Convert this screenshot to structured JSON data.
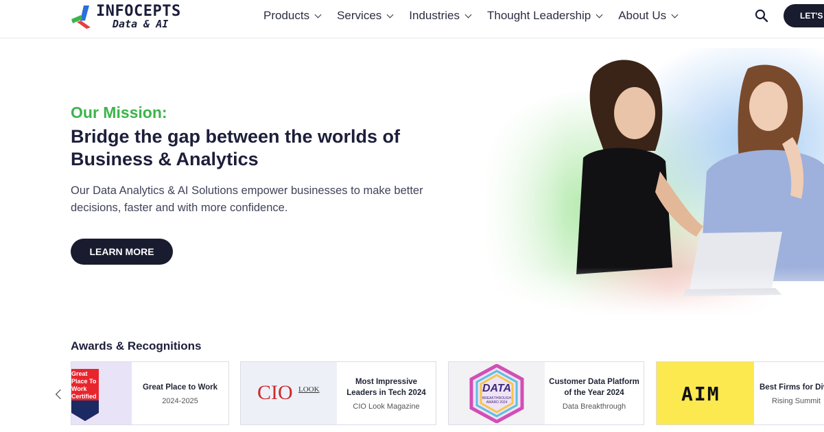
{
  "brand": {
    "name_line1": "INFOCEPTS",
    "name_line2": "Data & AI",
    "colors": {
      "green": "#3bb54a",
      "red": "#e8403b",
      "blue": "#2c6de0",
      "navy": "#191b2e"
    }
  },
  "nav": {
    "items": [
      {
        "label": "Products"
      },
      {
        "label": "Services"
      },
      {
        "label": "Industries"
      },
      {
        "label": "Thought Leadership"
      },
      {
        "label": "About Us"
      }
    ],
    "cta_label": "LET'S T"
  },
  "hero": {
    "kicker": "Our Mission:",
    "title": "Bridge the gap between the worlds of Business & Analytics",
    "subtitle": "Our Data Analytics & AI Solutions empower businesses to make better decisions, faster and with more confidence.",
    "button_label": "LEARN MORE"
  },
  "awards": {
    "heading": "Awards & Recognitions",
    "items": [
      {
        "title": "Great Place to Work",
        "org": "2024-2025",
        "thumb_text": "Great Place To Work Certified",
        "thumb_bg": "#e9e3f7"
      },
      {
        "title": "Most Impressive Leaders in Tech 2024",
        "org": "CIO Look Magazine",
        "thumb_text": "CIO",
        "thumb_sup": "LOOK",
        "thumb_bg": "#eef0f8"
      },
      {
        "title": "Customer Data Platform of the Year 2024",
        "org": "Data Breakthrough",
        "thumb_text": "DATA",
        "thumb_sub": "BREAKTHROUGH AWARD 2024",
        "thumb_bg": "#f2f2f4"
      },
      {
        "title": "Best Firms for Div & Inclusion in T",
        "org": "Rising Summit",
        "thumb_text": "AIM",
        "thumb_bg": "#fce94f"
      }
    ]
  }
}
